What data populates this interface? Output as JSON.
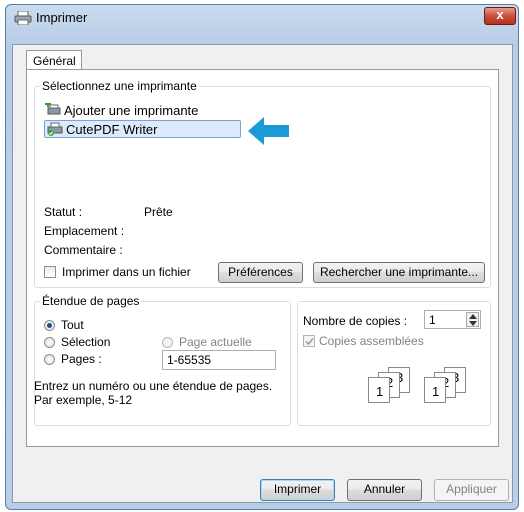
{
  "window": {
    "title": "Imprimer",
    "close_label": "x"
  },
  "tabs": [
    {
      "label": "Général"
    }
  ],
  "printer_group": {
    "legend": "Sélectionnez une imprimante",
    "printers": [
      {
        "label": "Ajouter une imprimante"
      },
      {
        "label": "CutePDF Writer"
      }
    ],
    "selected_index": 1,
    "status_label": "Statut :",
    "status_value": "Prête",
    "location_label": "Emplacement :",
    "comment_label": "Commentaire :",
    "print_to_file_label": "Imprimer dans un fichier",
    "preferences_label": "Préférences",
    "find_printer_label": "Rechercher une imprimante..."
  },
  "page_range": {
    "legend": "Étendue de pages",
    "all_label": "Tout",
    "selection_label": "Sélection",
    "current_page_label": "Page actuelle",
    "pages_label": "Pages :",
    "pages_value": "1-65535",
    "selected": "Tout",
    "help_line1": "Entrez un numéro ou une étendue de pages.",
    "help_line2": "Par exemple, 5-12"
  },
  "copies": {
    "label": "Nombre de copies :",
    "value": "1",
    "collate_label": "Copies assemblées",
    "collate_checked": true,
    "collate_disabled": true,
    "collate_icon_digits": [
      "1",
      "2",
      "3"
    ]
  },
  "footer": {
    "print_label": "Imprimer",
    "cancel_label": "Annuler",
    "apply_label": "Appliquer"
  },
  "colors": {
    "arrow": "#1a9ad6",
    "selection_bg": "#dcebfc",
    "selection_border": "#7da2ce"
  }
}
